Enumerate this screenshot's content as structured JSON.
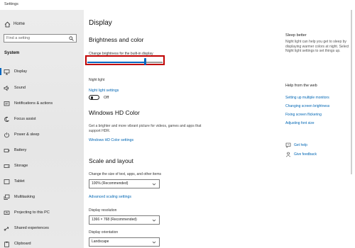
{
  "window": {
    "title": "Settings"
  },
  "sidebar": {
    "home": {
      "label": "Home",
      "icon": "home-icon"
    },
    "search": {
      "placeholder": "Find a setting",
      "icon": "search-icon"
    },
    "group_label": "System",
    "items": [
      {
        "label": "Display",
        "icon": "monitor-icon",
        "active": true
      },
      {
        "label": "Sound",
        "icon": "speaker-icon"
      },
      {
        "label": "Notifications & actions",
        "icon": "notification-icon"
      },
      {
        "label": "Focus assist",
        "icon": "moon-icon"
      },
      {
        "label": "Power & sleep",
        "icon": "power-icon"
      },
      {
        "label": "Battery",
        "icon": "battery-icon"
      },
      {
        "label": "Storage",
        "icon": "storage-icon"
      },
      {
        "label": "Tablet",
        "icon": "tablet-icon"
      },
      {
        "label": "Multitasking",
        "icon": "multitasking-icon"
      },
      {
        "label": "Projecting to this PC",
        "icon": "projecting-icon"
      },
      {
        "label": "Shared experiences",
        "icon": "shared-icon"
      },
      {
        "label": "Clipboard",
        "icon": "clipboard-icon"
      }
    ]
  },
  "main": {
    "title": "Display",
    "brightness": {
      "heading": "Brightness and color",
      "slider_label": "Change brightness for the built-in display",
      "slider_value_percent": 77
    },
    "night_light": {
      "label": "Night light",
      "state": "Off",
      "settings_link": "Night light settings"
    },
    "hd_color": {
      "heading": "Windows HD Color",
      "description": "Get a brighter and more vibrant picture for videos, games and apps that support HDR.",
      "settings_link": "Windows HD Color settings"
    },
    "scale_layout": {
      "heading": "Scale and layout",
      "scale_label": "Change the size of text, apps, and other items",
      "scale_value": "100% (Recommended)",
      "advanced_link": "Advanced scaling settings",
      "resolution_label": "Display resolution",
      "resolution_value": "1366 × 768 (Recommended)",
      "orientation_label": "Display orientation",
      "orientation_value": "Landscape"
    }
  },
  "right_panel": {
    "sleep_title": "Sleep better",
    "sleep_text": "Night light can help you get to sleep by displaying warmer colors at night. Select Night light settings to set things up.",
    "help_title": "Help from the web",
    "help_links": [
      "Setting up multiple monitors",
      "Changing screen brightness",
      "Fixing screen flickering",
      "Adjusting font size"
    ],
    "get_help": "Get help",
    "give_feedback": "Give feedback"
  },
  "colors": {
    "accent": "#0067c0",
    "highlight_box": "#c00000",
    "link": "#0066b4"
  }
}
